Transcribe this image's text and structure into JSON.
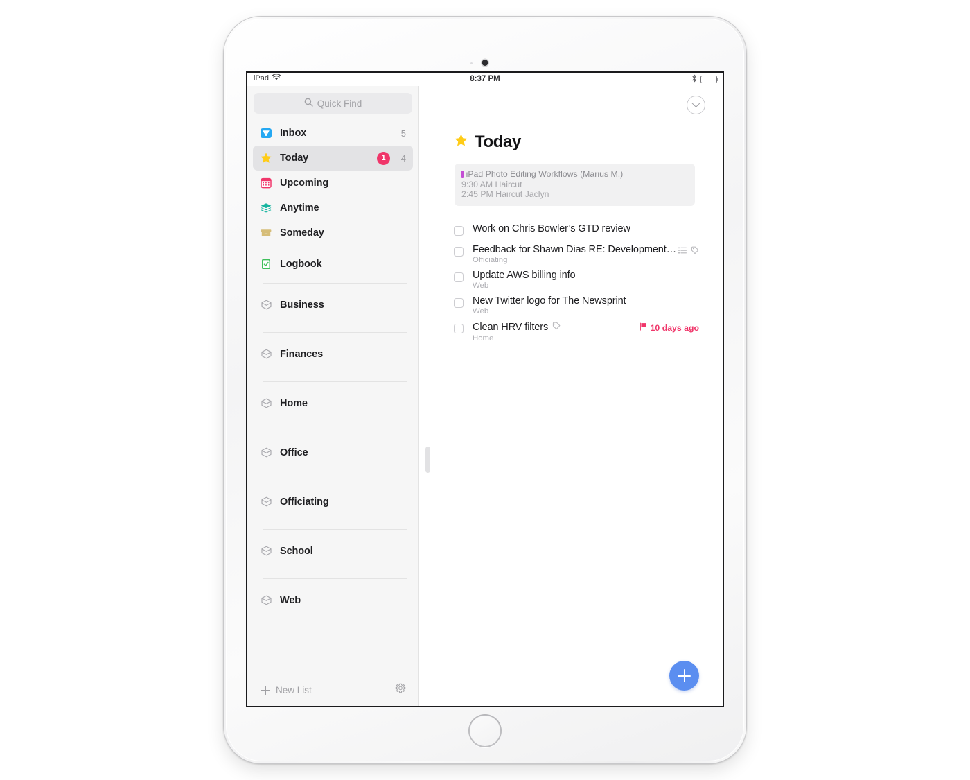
{
  "status_bar": {
    "device_label": "iPad",
    "wifi_icon": "wifi-icon",
    "time": "8:37 PM",
    "bluetooth_icon": "bluetooth-icon",
    "battery_icon": "battery-icon"
  },
  "sidebar": {
    "search": {
      "placeholder": "Quick Find",
      "value": "",
      "icon": "search-icon"
    },
    "nav_items": [
      {
        "key": "inbox",
        "label": "Inbox",
        "icon": "inbox-tray-icon",
        "count": "5",
        "badge": "",
        "selected": false
      },
      {
        "key": "today",
        "label": "Today",
        "icon": "star-icon",
        "count": "4",
        "badge": "1",
        "selected": true
      },
      {
        "key": "upcoming",
        "label": "Upcoming",
        "icon": "calendar-icon",
        "count": "",
        "badge": "",
        "selected": false
      },
      {
        "key": "anytime",
        "label": "Anytime",
        "icon": "layers-icon",
        "count": "",
        "badge": "",
        "selected": false
      },
      {
        "key": "someday",
        "label": "Someday",
        "icon": "archive-box-icon",
        "count": "",
        "badge": "",
        "selected": false
      },
      {
        "key": "logbook",
        "label": "Logbook",
        "icon": "logbook-check-icon",
        "count": "",
        "badge": "",
        "selected": false
      }
    ],
    "areas": [
      {
        "key": "business",
        "label": "Business",
        "icon": "area-cube-icon"
      },
      {
        "key": "finances",
        "label": "Finances",
        "icon": "area-cube-icon"
      },
      {
        "key": "home",
        "label": "Home",
        "icon": "area-cube-icon"
      },
      {
        "key": "office",
        "label": "Office",
        "icon": "area-cube-icon"
      },
      {
        "key": "officiating",
        "label": "Officiating",
        "icon": "area-cube-icon"
      },
      {
        "key": "school",
        "label": "School",
        "icon": "area-cube-icon"
      },
      {
        "key": "web",
        "label": "Web",
        "icon": "area-cube-icon"
      }
    ],
    "footer": {
      "new_list_label": "New List",
      "new_list_icon": "plus-icon",
      "settings_icon": "gear-icon"
    }
  },
  "main": {
    "collapse_icon": "chevron-down-circle-icon",
    "title": "Today",
    "title_icon": "star-icon",
    "calendar_card": {
      "lines": [
        "iPad Photo Editing Workflows (Marius M.)",
        "9:30 AM Haircut",
        "2:45 PM Haircut Jaclyn"
      ]
    },
    "tasks": [
      {
        "title": "Work on Chris Bowler’s GTD review",
        "subtitle": "",
        "checked": false,
        "icons": [],
        "due": "",
        "due_icon": ""
      },
      {
        "title": "Feedback for Shawn Dias RE: Development…",
        "subtitle": "Officiating",
        "checked": false,
        "icons": [
          "checklist-icon",
          "tag-icon"
        ],
        "due": "",
        "due_icon": ""
      },
      {
        "title": "Update AWS billing info",
        "subtitle": "Web",
        "checked": false,
        "icons": [],
        "due": "",
        "due_icon": ""
      },
      {
        "title": "New Twitter logo for The Newsprint",
        "subtitle": "Web",
        "checked": false,
        "icons": [],
        "due": "",
        "due_icon": ""
      },
      {
        "title": "Clean HRV filters",
        "subtitle": "Home",
        "checked": false,
        "icons": [
          "tag-icon"
        ],
        "due": "10 days ago",
        "due_icon": "flag-icon"
      }
    ],
    "add_button": {
      "icon": "plus-icon",
      "label": ""
    }
  },
  "colors": {
    "accent_blue": "#5b8ef0",
    "badge_pink": "#f0366a",
    "star_yellow": "#ffcc17",
    "inbox_blue": "#25a8f2",
    "calendar_pink": "#f0366a",
    "anytime_teal": "#17b5a0",
    "someday_tan": "#d6bd78",
    "logbook_green": "#3fbf5b",
    "event_purple": "#c44fd4",
    "sidebar_bg": "#f6f6f6",
    "selected_row": "#e3e3e5"
  }
}
